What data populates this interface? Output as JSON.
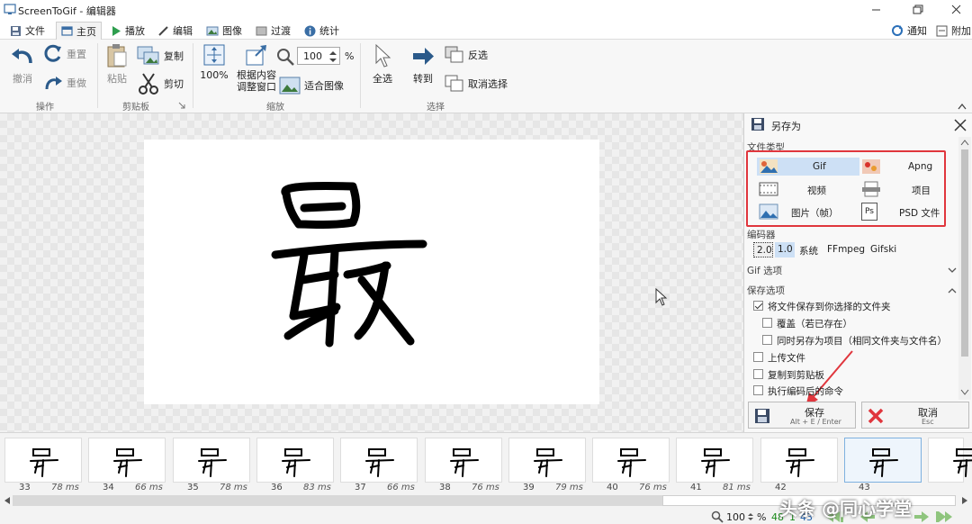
{
  "window": {
    "title": "ScreenToGif - 编辑器",
    "controls": [
      "minimize-icon",
      "restore-icon",
      "close-icon"
    ]
  },
  "tabs": [
    {
      "label": "文件",
      "icon": "save-icon",
      "active": false
    },
    {
      "label": "主页",
      "icon": "home-icon",
      "active": true
    },
    {
      "label": "播放",
      "icon": "play-icon",
      "active": false
    },
    {
      "label": "编辑",
      "icon": "pencil-icon",
      "active": false
    },
    {
      "label": "图像",
      "icon": "image-icon",
      "active": false
    },
    {
      "label": "过渡",
      "icon": "transition-icon",
      "active": false
    },
    {
      "label": "统计",
      "icon": "info-icon",
      "active": false
    }
  ],
  "tabs_right": {
    "notify_label": "通知",
    "attach_label": "附加"
  },
  "ribbon": {
    "undo": "撤消",
    "redo": "重做",
    "reset": "重置",
    "group_action": "操作",
    "paste": "粘贴",
    "copy": "复制",
    "cut": "剪切",
    "group_clipboard": "剪贴板",
    "zoom_100": "100%",
    "fit_content": "根据内容\n调整窗口",
    "zoom_value": "100",
    "zoom_unit": "%",
    "fit_image": "适合图像",
    "group_zoom": "缩放",
    "select_all": "全选",
    "goto": "转到",
    "invert": "反选",
    "deselect": "取消选择",
    "group_select": "选择"
  },
  "panel": {
    "title": "另存为",
    "file_type_label": "文件类型",
    "file_types": [
      {
        "label": "Gif",
        "icon": "gif-icon",
        "selected": true
      },
      {
        "label": "Apng",
        "icon": "apng-icon",
        "selected": false
      },
      {
        "label": "视频",
        "icon": "video-icon",
        "selected": false
      },
      {
        "label": "项目",
        "icon": "project-icon",
        "selected": false
      },
      {
        "label": "图片（帧）",
        "icon": "picture-frame-icon",
        "selected": false
      },
      {
        "label": "PSD 文件",
        "icon": "psd-icon",
        "selected": false
      }
    ],
    "psd_icon_text": "Ps",
    "encoder_label": "编码器",
    "encoders": [
      {
        "label": "2.0",
        "selected": false
      },
      {
        "label": "1.0",
        "selected": true
      },
      {
        "label": "系统",
        "selected": false
      },
      {
        "label": "FFmpeg",
        "selected": false
      },
      {
        "label": "Gifski",
        "selected": false
      }
    ],
    "gif_options_label": "Gif 选项",
    "save_options_label": "保存选项",
    "options": [
      {
        "label": "将文件保存到你选择的文件夹",
        "checked": true,
        "indent": 0
      },
      {
        "label": "覆盖（若已存在）",
        "checked": false,
        "indent": 1
      },
      {
        "label": "同时另存为项目（相同文件夹与文件名）",
        "checked": false,
        "indent": 1
      },
      {
        "label": "上传文件",
        "checked": false,
        "indent": 0
      },
      {
        "label": "复制到剪贴板",
        "checked": false,
        "indent": 0
      },
      {
        "label": "执行编码后的命令",
        "checked": false,
        "indent": 0
      }
    ],
    "save_label": "保存",
    "save_shortcut": "Alt + E / Enter",
    "cancel_label": "取消",
    "cancel_shortcut": "Esc",
    "accent_color": "#e0363d"
  },
  "frames": [
    {
      "number": "33",
      "delay": "78 ms"
    },
    {
      "number": "34",
      "delay": "66 ms"
    },
    {
      "number": "35",
      "delay": "78 ms"
    },
    {
      "number": "36",
      "delay": "83 ms"
    },
    {
      "number": "37",
      "delay": "66 ms"
    },
    {
      "number": "38",
      "delay": "76 ms"
    },
    {
      "number": "39",
      "delay": "79 ms"
    },
    {
      "number": "40",
      "delay": "76 ms"
    },
    {
      "number": "41",
      "delay": "81 ms"
    },
    {
      "number": "42",
      "delay": ""
    },
    {
      "number": "43",
      "delay": ""
    },
    {
      "number": "",
      "delay": ""
    }
  ],
  "status": {
    "zoom": "100",
    "zoom_unit": "%",
    "total_frames": "48",
    "selected_frames": "1",
    "current_frame": "43",
    "total_color": "#1a8a1a",
    "selected_color": "#1a8a1a",
    "current_color": "#1c5fb0"
  },
  "watermark": "头条 @同心学堂"
}
